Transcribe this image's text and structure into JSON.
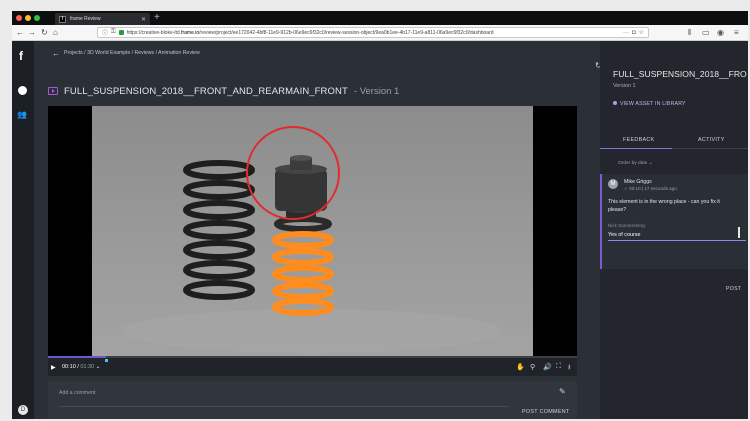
{
  "browser": {
    "tab_title": "frame Review",
    "tab_favicon": "f",
    "url_host": "creative-bloke-ltd.",
    "url_domain": "frame.io",
    "url_path": "/review/project/ee172042-4bf8-11e9-912b-06e9ec6f32c0/review-session-object/9ea0b1ee-4b17-11e9-a811-06a9ec6f32c0/dashboard",
    "url_prefix": "https://",
    "colors": {
      "close": "#ff5f57",
      "minimize": "#ffbd2e",
      "maximize": "#28c840"
    }
  },
  "rail": {
    "logo": "f",
    "avatar": "D",
    "icons": [
      "circle-icon",
      "users-icon"
    ]
  },
  "main": {
    "breadcrumb": "Projects / 3D World Example / Reviews / Animation Review",
    "title": "FULL_SUSPENSION_2018__FRONT_AND_REARMAIN_FRONT",
    "version_label": " - Version 1",
    "playback": {
      "current_time": "00:10",
      "duration": "01:30",
      "progress": 0.11
    },
    "comment": {
      "placeholder": "Add a comment",
      "post_label": "POST COMMENT"
    }
  },
  "panel": {
    "asset_title": "FULL_SUSPENSION_2018__FRO",
    "version": "Version 1",
    "view_library": "VIEW ASSET IN LIBRARY",
    "tabs": [
      {
        "label": "FEEDBACK",
        "active": true
      },
      {
        "label": "ACTIVITY",
        "active": false
      }
    ],
    "order_label": "Order by date",
    "comment": {
      "avatar": "M",
      "author": "Mike Griggs",
      "meta": "00:10 | 17 seconds ago",
      "body": "This element is in the wrong place - can you fix it please?"
    },
    "reply": {
      "author_hint": "Nick Sommerberg",
      "value": "Yes of course",
      "post_label": "POST"
    },
    "accent": "#7c5cd6"
  }
}
